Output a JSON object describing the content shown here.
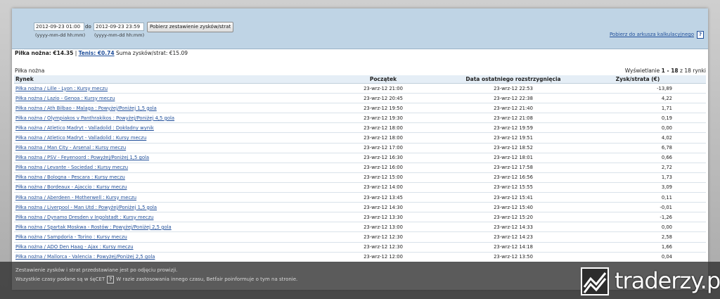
{
  "filter": {
    "from_value": "2012-09-23 01:00",
    "to_word": "do",
    "to_value": "2012-09-23 23:59",
    "format_hint": "(yyyy-mm-dd hh:mm)",
    "submit_label": "Pobierz zestawienie zysków/strat",
    "excel_link": "Pobierz do arkusza kalkulacyjnego",
    "help_glyph": "?"
  },
  "summary": {
    "football": "Piłka nożna: €14.35",
    "separator": "|",
    "tennis": "Tenis: €0.74",
    "total_label": "Suma zysków/strat:",
    "total_value": "€15.09"
  },
  "section_title": "Piłka nożna",
  "pager": {
    "prefix": "Wyświetlanie",
    "range": "1 - 18",
    "suffix": "z 18 rynki"
  },
  "table": {
    "headers": [
      "Rynek",
      "Początek",
      "Data ostatniego rozstrzygnięcia",
      "Zysk/strata (€)"
    ],
    "rows": [
      [
        "Piłka nożna / Lille - Lyon : Kursy meczu",
        "23-wrz-12 21:00",
        "23-wrz-12 22:53",
        "-13,89"
      ],
      [
        "Piłka nożna / Lazio - Genoa : Kursy meczu",
        "23-wrz-12 20:45",
        "23-wrz-12 22:38",
        "4,22"
      ],
      [
        "Piłka nożna / Ath Bilbao - Malaga : Powyżej/Poniżej 1,5 gola",
        "23-wrz-12 19:50",
        "23-wrz-12 21:40",
        "1,71"
      ],
      [
        "Piłka nożna / Olympiakos v Panthrakikos : Powyżej/Poniżej 4,5 gola",
        "23-wrz-12 19:30",
        "23-wrz-12 21:08",
        "0,19"
      ],
      [
        "Piłka nożna / Atletico Madryt - Valladolid : Dokładny wynik",
        "23-wrz-12 18:00",
        "23-wrz-12 19:59",
        "0,00"
      ],
      [
        "Piłka nożna / Atletico Madryt - Valladolid : Kursy meczu",
        "23-wrz-12 18:00",
        "23-wrz-12 19:51",
        "4,02"
      ],
      [
        "Piłka nożna / Man City - Arsenal : Kursy meczu",
        "23-wrz-12 17:00",
        "23-wrz-12 18:52",
        "6,78"
      ],
      [
        "Piłka nożna / PSV - Feyenoord : Powyżej/Poniżej 1,5 gola",
        "23-wrz-12 16:30",
        "23-wrz-12 18:01",
        "0,66"
      ],
      [
        "Piłka nożna / Levante - Sociedad : Kursy meczu",
        "23-wrz-12 16:00",
        "23-wrz-12 17:58",
        "2,72"
      ],
      [
        "Piłka nożna / Bologna - Pescara : Kursy meczu",
        "23-wrz-12 15:00",
        "23-wrz-12 16:56",
        "1,73"
      ],
      [
        "Piłka nożna / Bordeaux - Ajaccio : Kursy meczu",
        "23-wrz-12 14:00",
        "23-wrz-12 15:55",
        "3,09"
      ],
      [
        "Piłka nożna / Aberdeen - Motherwell : Kursy meczu",
        "23-wrz-12 13:45",
        "23-wrz-12 15:41",
        "0,11"
      ],
      [
        "Piłka nożna / Liverpool - Man Utd : Powyżej/Poniżej 1,5 gola",
        "23-wrz-12 14:30",
        "23-wrz-12 15:40",
        "-0,01"
      ],
      [
        "Piłka nożna / Dynamo Dresden v Ingolstadt : Kursy meczu",
        "23-wrz-12 13:30",
        "23-wrz-12 15:20",
        "-1,26"
      ],
      [
        "Piłka nożna / Spartak Moskwa - Rostów : Powyżej/Poniżej 2,5 gola",
        "23-wrz-12 13:00",
        "23-wrz-12 14:33",
        "0,00"
      ],
      [
        "Piłka nożna / Sampdoria - Torino : Kursy meczu",
        "23-wrz-12 12:30",
        "23-wrz-12 14:23",
        "2,58"
      ],
      [
        "Piłka nożna / ADO Den Haag - Ajax : Kursy meczu",
        "23-wrz-12 12:30",
        "23-wrz-12 14:18",
        "1,66"
      ],
      [
        "Piłka nożna / Mallorca - Valencia : Powyżej/Poniżej 2,5 gola",
        "23-wrz-12 12:00",
        "23-wrz-12 13:50",
        "0,04"
      ]
    ]
  },
  "footer": {
    "line1": "Zestawienie zysków i strat przedstawiane jest po odjęciu prowizji.",
    "line2_a": "Wszystkie czasy podane są w śęCET",
    "line2_b": "W razie zastosowania innego czasu, Betfair poinformuje o tym na stronie.",
    "help_glyph": "?"
  },
  "watermark": "traderzy.pl",
  "colors": {
    "header_band": "#bfd4e5",
    "link": "#1f4e9a",
    "table_header": "#e5eef6"
  }
}
